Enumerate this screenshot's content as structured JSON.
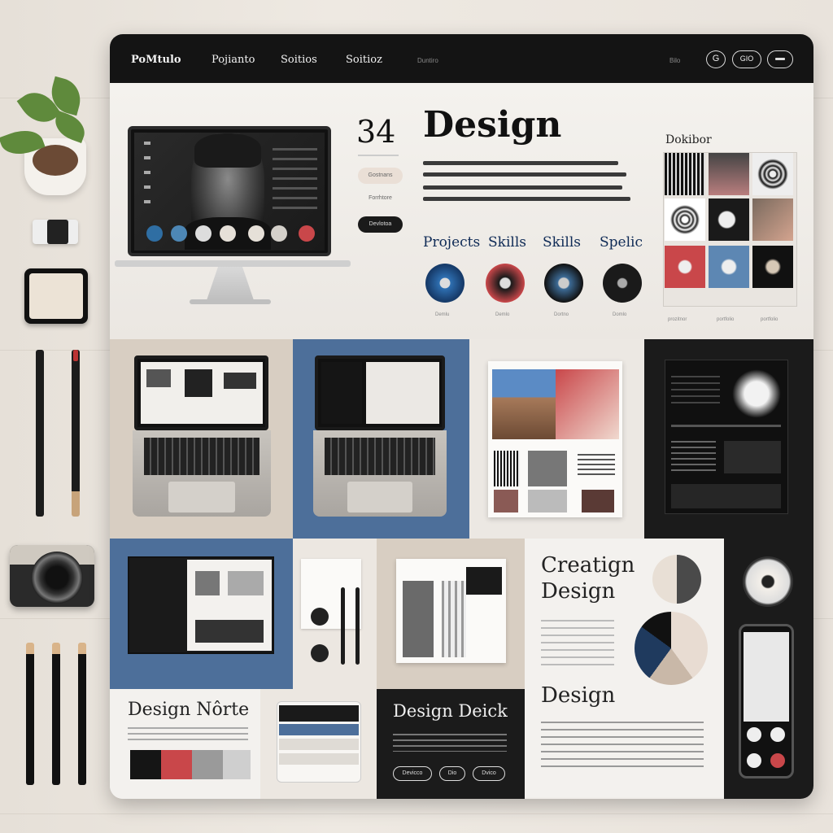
{
  "nav": {
    "logo": "PoMtulo",
    "items": [
      "Pojianto",
      "Soitios",
      "Soitioz"
    ],
    "small": "Duntiro",
    "right_small": "Bilo",
    "pill_labels": [
      "G",
      "GIO",
      ""
    ]
  },
  "hero": {
    "number": "34",
    "title": "Design",
    "pill_top": "Gostnans",
    "pill_mid": "Forrhtore",
    "pill_dark": "Devlotoa",
    "categories": [
      "Projects",
      "Skills",
      "Skills",
      "Spelic"
    ],
    "captions": [
      "Demlu",
      "Demlo",
      "Dortno",
      "Domlo"
    ],
    "gallery_title": "Dokibor",
    "gallery_captions": [
      "prozitnor",
      "portfolio",
      "portfolio"
    ]
  },
  "lower": {
    "creation_title_1": "Creatign",
    "creation_title_2": "Design",
    "design_label": "Design",
    "design_noire": "Design Nôrte",
    "design_deick": "Design Deick",
    "deick_buttons": [
      "Devicco",
      "Dio",
      "Dvico"
    ]
  },
  "colors": {
    "topbar": "#141414",
    "accent_blue": "#4d6f9a",
    "accent_red": "#c9474a",
    "dark_panel": "#1b1b1b",
    "beige_panel": "#d8cec2"
  },
  "icons": [
    "plant-icon",
    "camera-icon",
    "pencil-icon",
    "laptop-icon",
    "phone-icon"
  ]
}
